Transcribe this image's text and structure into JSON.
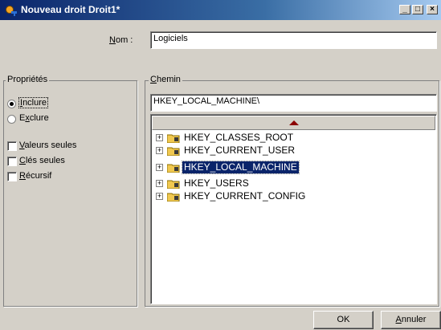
{
  "window": {
    "title": "Nouveau droit Droit1*"
  },
  "name_field": {
    "label": "Nom :",
    "value": "Logiciels"
  },
  "properties": {
    "legend": "Propriétés",
    "radios": [
      {
        "label": "Inclure",
        "selected": true
      },
      {
        "label": "Exclure",
        "selected": false
      }
    ],
    "checkboxes": [
      {
        "label": "Valeurs seules",
        "checked": false
      },
      {
        "label": "Clés seules",
        "checked": false
      },
      {
        "label": "Récursif",
        "checked": false
      }
    ]
  },
  "path": {
    "legend": "Chemin",
    "value": "HKEY_LOCAL_MACHINE\\",
    "tree": [
      {
        "label": "HKEY_CLASSES_ROOT",
        "selected": false
      },
      {
        "label": "HKEY_CURRENT_USER",
        "selected": false
      },
      {
        "label": "HKEY_LOCAL_MACHINE",
        "selected": true
      },
      {
        "label": "HKEY_USERS",
        "selected": false
      },
      {
        "label": "HKEY_CURRENT_CONFIG",
        "selected": false
      }
    ]
  },
  "buttons": {
    "ok": "OK",
    "cancel": "Annuler"
  },
  "colors": {
    "titlebar": "#0a246a",
    "selection": "#0a246a",
    "scroll_arrow": "#8b0000",
    "dialog_bg": "#d4d0c8"
  },
  "icons": {
    "app": "app-key-icon",
    "folder": "registry-folder-icon",
    "expand": "plus-expand-icon"
  }
}
